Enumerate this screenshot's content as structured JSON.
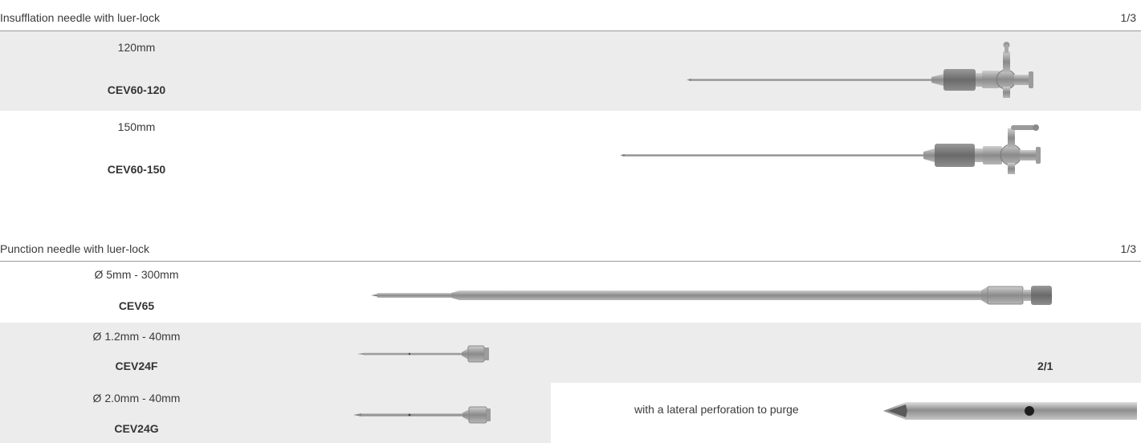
{
  "sections": [
    {
      "title": "Insufflation needle with luer-lock",
      "scale": "1/3",
      "products": [
        {
          "size": "120mm",
          "code": "CEV60-120"
        },
        {
          "size": "150mm",
          "code": "CEV60-150"
        }
      ]
    },
    {
      "title": "Punction needle with luer-lock",
      "scale": "1/3",
      "products": [
        {
          "size": "Ø 5mm - 300mm",
          "code": "CEV65"
        },
        {
          "size": "Ø 1.2mm - 40mm",
          "code": "CEV24F"
        },
        {
          "size": "Ø 2.0mm - 40mm",
          "code": "CEV24G"
        }
      ],
      "detail": {
        "note": "with a lateral perforation to purge",
        "scale": "2/1"
      }
    }
  ]
}
